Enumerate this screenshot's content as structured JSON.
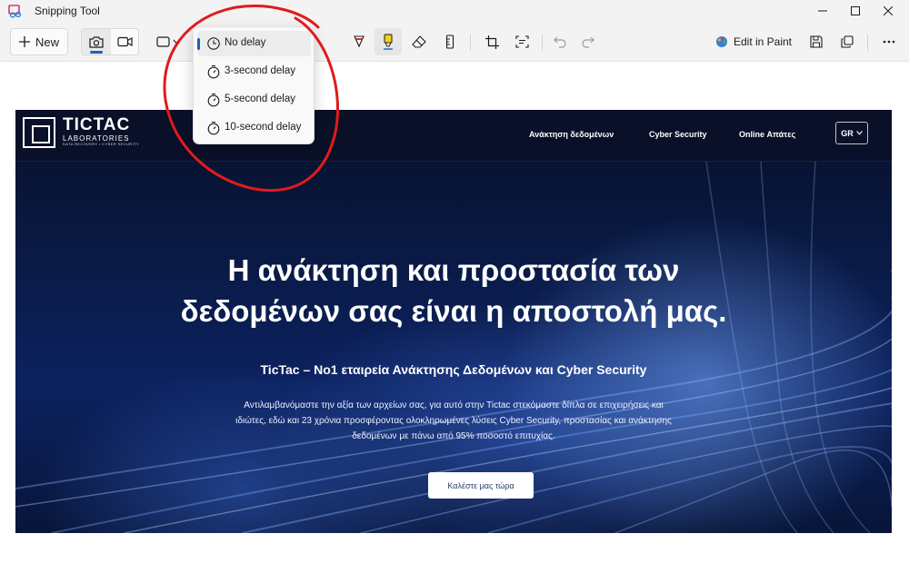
{
  "app": {
    "title": "Snipping Tool"
  },
  "toolbar": {
    "new_label": "New",
    "edit_in_paint_label": "Edit in Paint",
    "accent": "#1b63b8"
  },
  "delay_menu": {
    "items": [
      {
        "label": "No delay",
        "selected": true,
        "icon": "clock-icon"
      },
      {
        "label": "3-second delay",
        "selected": false,
        "icon": "timer-icon"
      },
      {
        "label": "5-second delay",
        "selected": false,
        "icon": "timer-icon"
      },
      {
        "label": "10-second delay",
        "selected": false,
        "icon": "timer-icon"
      }
    ]
  },
  "website": {
    "logo": {
      "name": "TICTAC",
      "sub": "LABORATORIES",
      "tagline": "DATA RECOVERY • CYBER SECURITY"
    },
    "nav": [
      "Ανάκτηση δεδομένων",
      "Cyber Security",
      "Online Απάτες"
    ],
    "language": "GR",
    "hero_title_line1": "Η ανάκτηση και προστασία των",
    "hero_title_line2": "δεδομένων σας είναι η αποστολή μας.",
    "hero_subtitle": "TicTac – Νο1 εταιρεία Ανάκτησης Δεδομένων και Cyber Security",
    "hero_description": "Αντιλαμβανόμαστε την αξία των αρχείων σας, για αυτό στην Tictac στεκόμαστε δίπλα σε επιχειρήσεις και ιδιώτες, εδώ και 23 χρόνια προσφέροντας ολοκληρωμένες λύσεις Cyber Security, προστασίας και ανάκτησης δεδομένων με πάνω από 95% ποσοστό επιτυχίας.",
    "cta_label": "Καλέστε μας τώρα"
  },
  "annotation": {
    "color": "#e01b1b"
  }
}
